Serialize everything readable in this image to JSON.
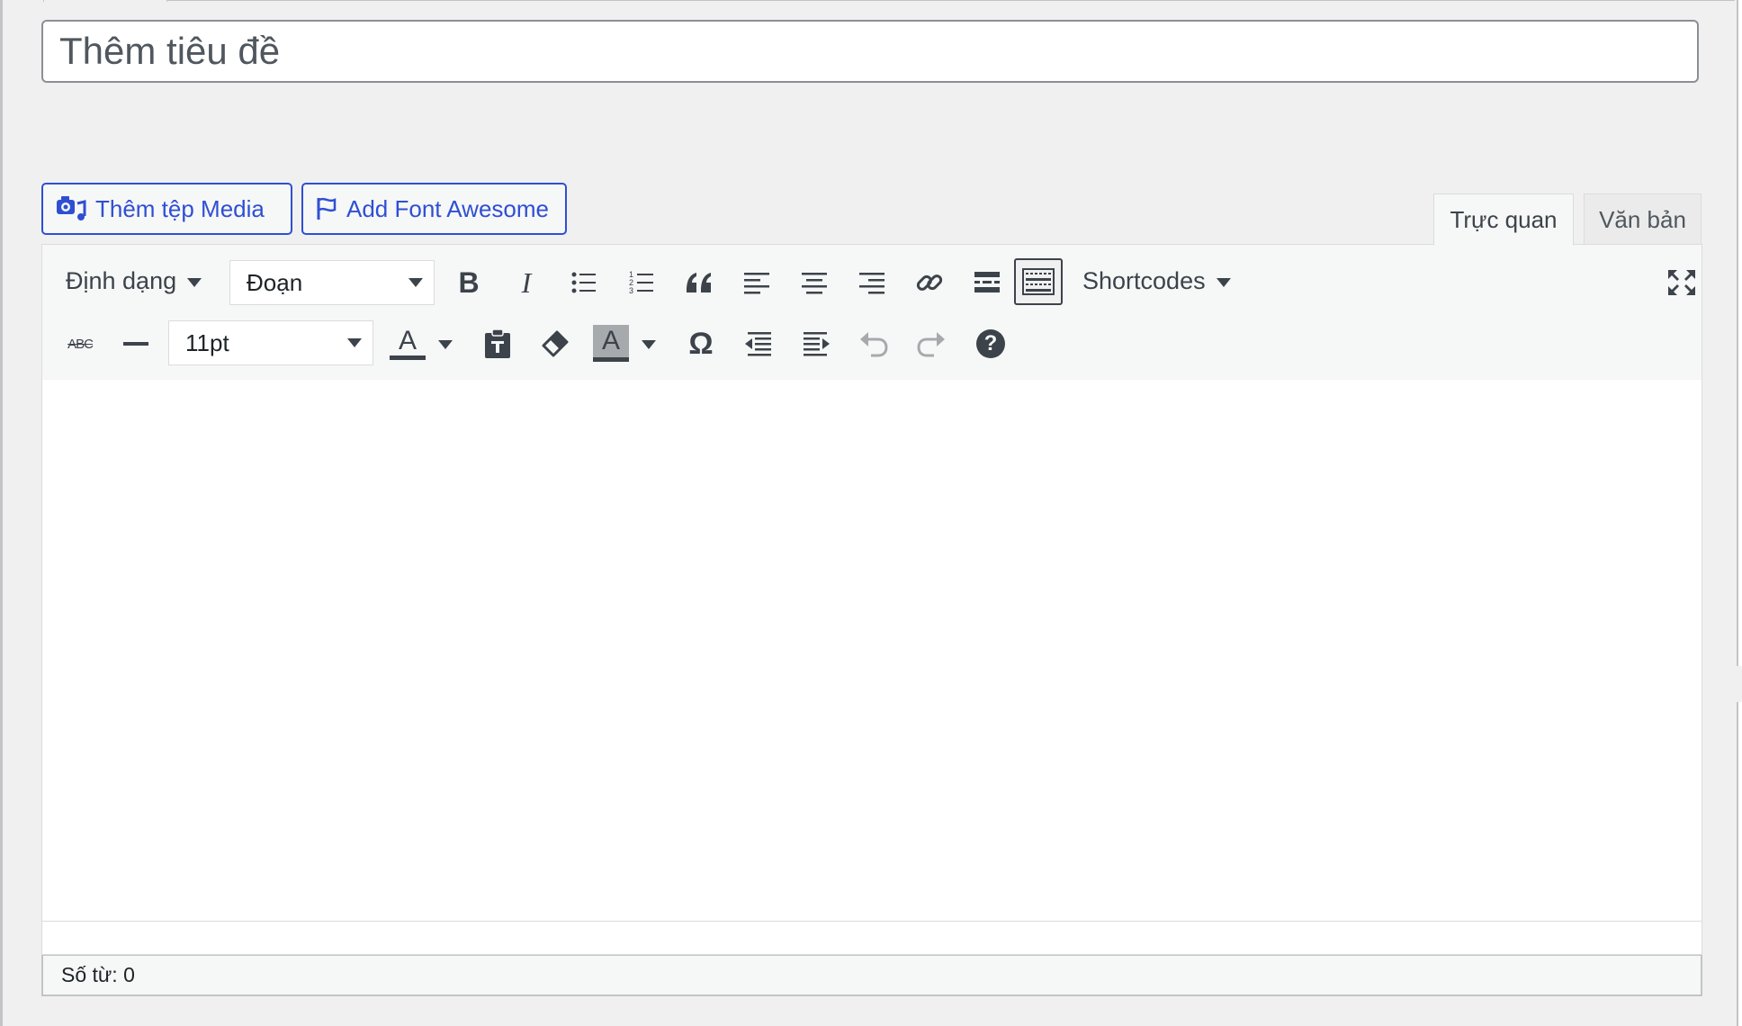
{
  "title_input": {
    "placeholder": "Thêm tiêu đề"
  },
  "media_buttons": [
    {
      "label": "Thêm tệp Media",
      "icon": "media-camera-icon"
    },
    {
      "label": "Add Font Awesome",
      "icon": "flag-icon"
    }
  ],
  "editor_tabs": {
    "visual": "Trực quan",
    "text": "Văn bản",
    "active": "visual"
  },
  "toolbar": {
    "format_menu": "Định dạng",
    "paragraph_select": "Đoạn",
    "shortcodes_menu": "Shortcodes",
    "font_size_select": "11pt",
    "strikethrough_text": "ABC",
    "buttons_row1": [
      "bold",
      "italic",
      "bullet-list",
      "numbered-list",
      "blockquote",
      "align-left",
      "align-center",
      "align-right",
      "link",
      "read-more",
      "toolbar-toggle",
      "fullscreen"
    ],
    "buttons_row2": [
      "strikethrough",
      "horizontal-line",
      "text-color",
      "paste-text",
      "clear-formatting",
      "background-color",
      "special-character",
      "outdent",
      "indent",
      "undo",
      "redo",
      "help"
    ],
    "bold_glyph": "B",
    "italic_glyph": "I",
    "color_glyph": "A",
    "omega_glyph": "Ω",
    "help_glyph": "?"
  },
  "status": {
    "word_count": "Số từ: 0"
  },
  "colors": {
    "link_blue": "#2f4fd3",
    "toolbar_bg": "#f6f7f7",
    "page_bg": "#f0f0f1",
    "icon": "#3c434a"
  }
}
